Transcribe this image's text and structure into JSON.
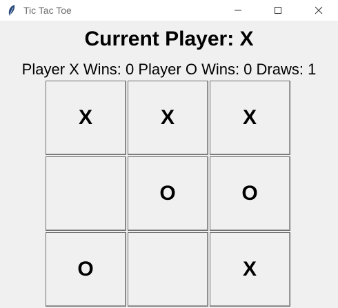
{
  "window": {
    "title": "Tic Tac Toe",
    "icon": "feather-icon",
    "controls": [
      "minimize-icon",
      "maximize-icon",
      "close-icon"
    ]
  },
  "status": {
    "current_player": "Current Player: X",
    "scoreline": "Player X Wins: 0 Player O Wins: 0 Draws: 1"
  },
  "board": {
    "cells": [
      "X",
      "X",
      "X",
      "",
      "O",
      "O",
      "O",
      "",
      "X"
    ]
  },
  "colors": {
    "background": "#f0f0f0",
    "titlebar": "#ffffff",
    "text": "#000000"
  }
}
